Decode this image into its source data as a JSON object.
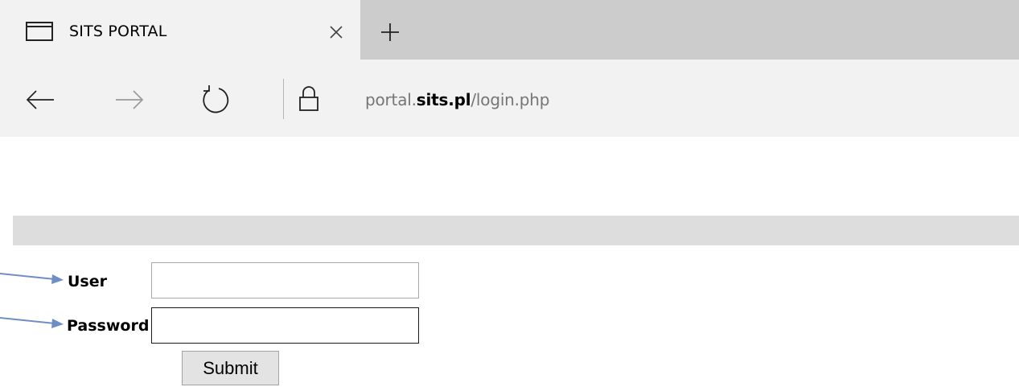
{
  "browser": {
    "tab_title": "SITS PORTAL",
    "url": {
      "prefix": "portal.",
      "domain": "sits.pl",
      "path": "/login.php"
    }
  },
  "login_form": {
    "user_label": "User",
    "user_value": "",
    "password_label": "Password",
    "password_value": "",
    "submit_label": "Submit"
  },
  "icons": {
    "tab": "window-tab-icon",
    "close": "close-icon",
    "new_tab": "plus-icon",
    "back": "arrow-left-icon",
    "forward": "arrow-right-icon",
    "refresh": "refresh-icon",
    "lock": "lock-icon",
    "annotation_arrow": "annotation-arrow-icon"
  },
  "colors": {
    "tab_strip": "#cccccc",
    "active_tab": "#f2f2f2",
    "page_bar": "#dddddd",
    "url_text": "#767676",
    "annotation_arrow": "#6f8fc4"
  }
}
